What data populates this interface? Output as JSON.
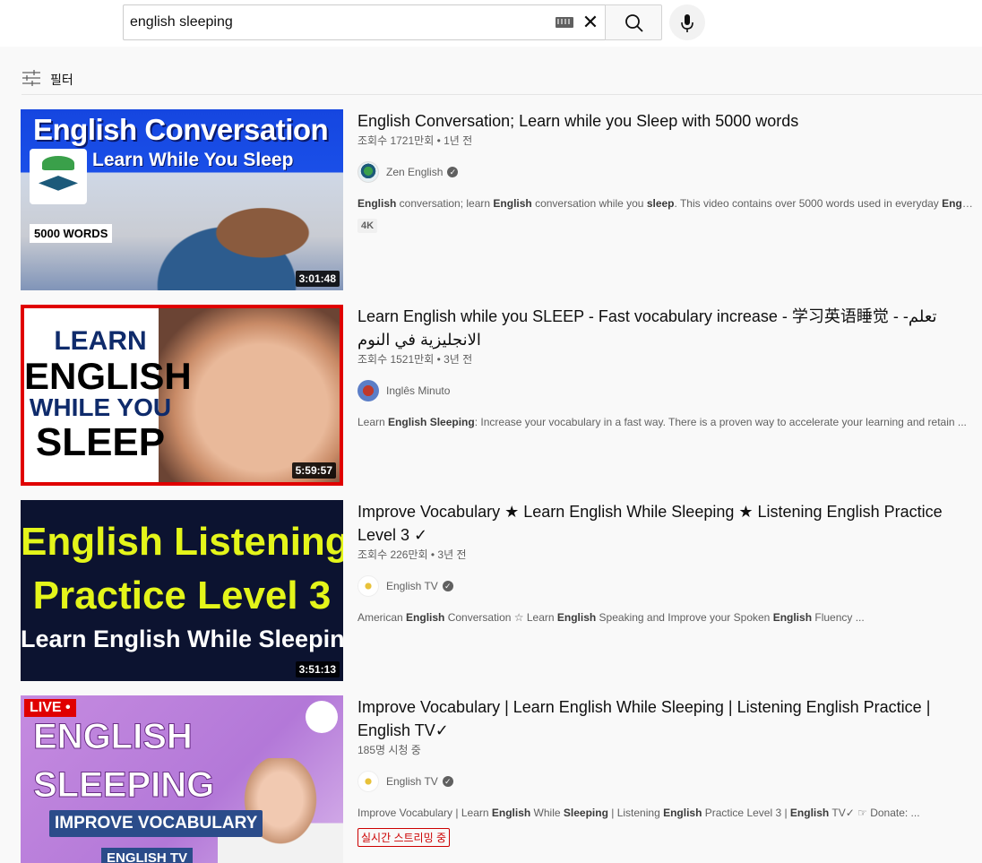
{
  "search": {
    "query": "english sleeping"
  },
  "filter": {
    "label": "필터"
  },
  "results": [
    {
      "title": "English Conversation; Learn while you Sleep with 5000 words",
      "views": "조회수 1721만회 • 1년 전",
      "channel": "Zen English",
      "verified": true,
      "description_html": "<b>English</b> conversation; learn <b>English</b> conversation while you <b>sleep</b>. This video contains over 5000 words used in everyday <b>English</b> ...",
      "badge": "4K",
      "duration": "3:01:48",
      "thumb_text": {
        "title": "English Conversation",
        "subtitle": "Learn While You Sleep",
        "words": "5000 WORDS"
      }
    },
    {
      "title": "Learn English while you SLEEP - Fast vocabulary increase - 学习英语睡觉 - -تعلم الانجليزية في النوم",
      "views": "조회수 1521만회 • 3년 전",
      "channel": "Inglês Minuto",
      "verified": false,
      "description_html": "Learn <b>English Sleeping</b>: Increase your vocabulary in a fast way. There is a proven way to accelerate your learning and retain ...",
      "duration": "5:59:57",
      "thumb_text": {
        "l1": "LEARN",
        "l2": "ENGLISH",
        "l3": "WHILE YOU",
        "l4": "SLEEP"
      }
    },
    {
      "title": "Improve Vocabulary ★ Learn English While Sleeping ★ Listening English Practice Level 3 ✓",
      "views": "조회수 226만회 • 3년 전",
      "channel": "English TV",
      "verified": true,
      "description_html": "American <b>English</b> Conversation ☆ Learn <b>English</b> Speaking and Improve your Spoken <b>English</b> Fluency ...",
      "duration": "3:51:13",
      "thumb_text": {
        "l1": "English Listening",
        "l2": "Practice Level 3",
        "l3": "Learn English While Sleeping"
      }
    },
    {
      "title": "Improve Vocabulary | Learn English While Sleeping | Listening English Practice | English TV✓",
      "views": "185명 시청 중",
      "channel": "English TV",
      "verified": true,
      "description_html": "Improve Vocabulary | Learn <b>English</b> While <b>Sleeping</b> | Listening <b>English</b> Practice Level 3 | <b>English</b> TV✓ ☞ Donate: ...",
      "live_badge": "실시간 스트리밍 중",
      "thumb_text": {
        "live": "LIVE •",
        "l1": "ENGLISH",
        "l2": "SLEEPING",
        "pill": "IMPROVE VOCABULARY",
        "pill2": "ENGLISH TV"
      }
    }
  ]
}
